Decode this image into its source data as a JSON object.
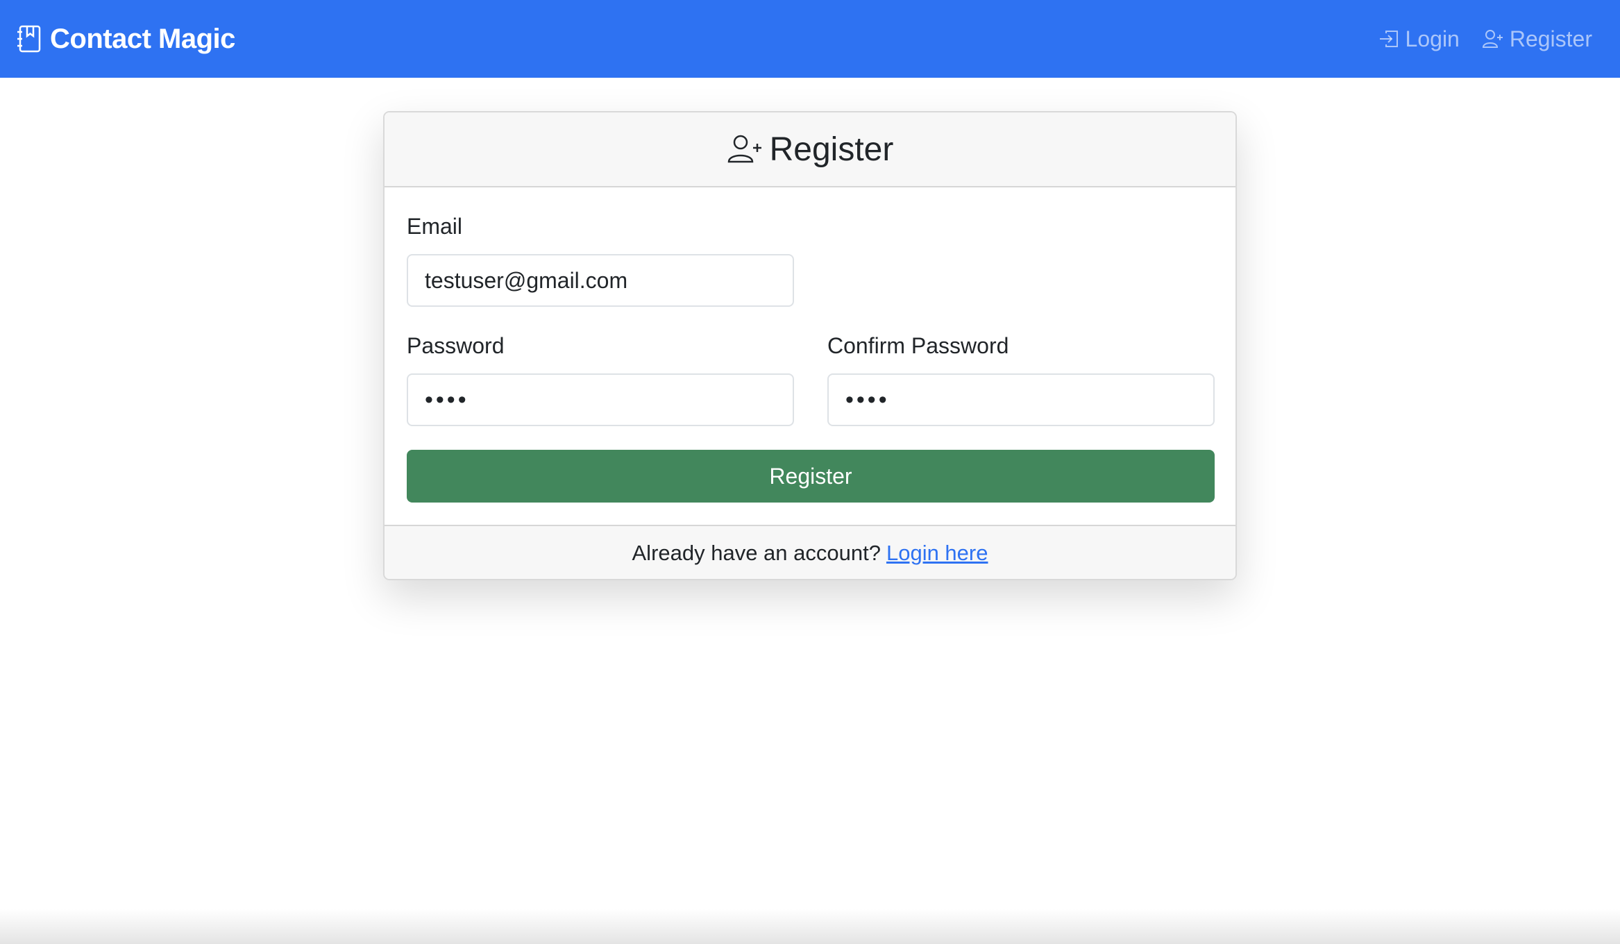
{
  "navbar": {
    "brand": "Contact Magic",
    "brand_icon": "journal-bookmark-icon",
    "links": [
      {
        "label": "Login",
        "icon": "box-arrow-in-right-icon"
      },
      {
        "label": "Register",
        "icon": "person-plus-icon"
      }
    ],
    "colors": {
      "background": "#2e72f2",
      "link": "rgba(255,255,255,0.6)"
    }
  },
  "card": {
    "title": "Register",
    "title_icon": "person-plus-icon",
    "fields": {
      "email": {
        "label": "Email",
        "value": "testuser@gmail.com"
      },
      "password": {
        "label": "Password",
        "value": "••••"
      },
      "confirm_password": {
        "label": "Confirm Password",
        "value": "••••"
      }
    },
    "submit_label": "Register",
    "footer_text": "Already have an account?",
    "footer_link": "Login here"
  },
  "colors": {
    "accent": "#2e72f2",
    "submit": "#42875c"
  }
}
